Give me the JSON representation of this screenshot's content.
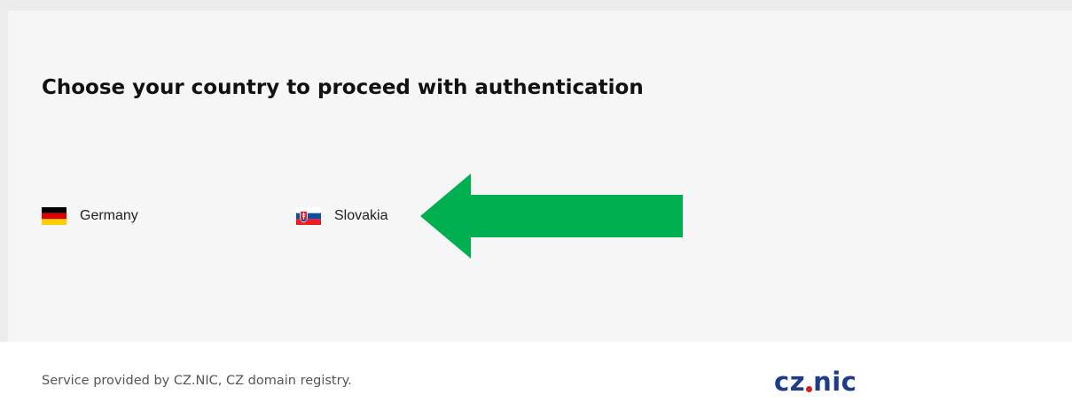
{
  "page": {
    "title": "Choose your country to proceed with authentication"
  },
  "countries": [
    {
      "label": "Germany",
      "flag_icon": "germany-flag-icon"
    },
    {
      "label": "Slovakia",
      "flag_icon": "slovakia-flag-icon"
    }
  ],
  "annotation": {
    "arrow_icon": "left-arrow-icon",
    "arrow_color": "#00b050"
  },
  "footer": {
    "text": "Service provided by CZ.NIC, CZ domain registry.",
    "logo_left": "cz",
    "logo_right": "nic",
    "logo_color": "#1f3c88",
    "logo_dot_color": "#d81e1e"
  }
}
